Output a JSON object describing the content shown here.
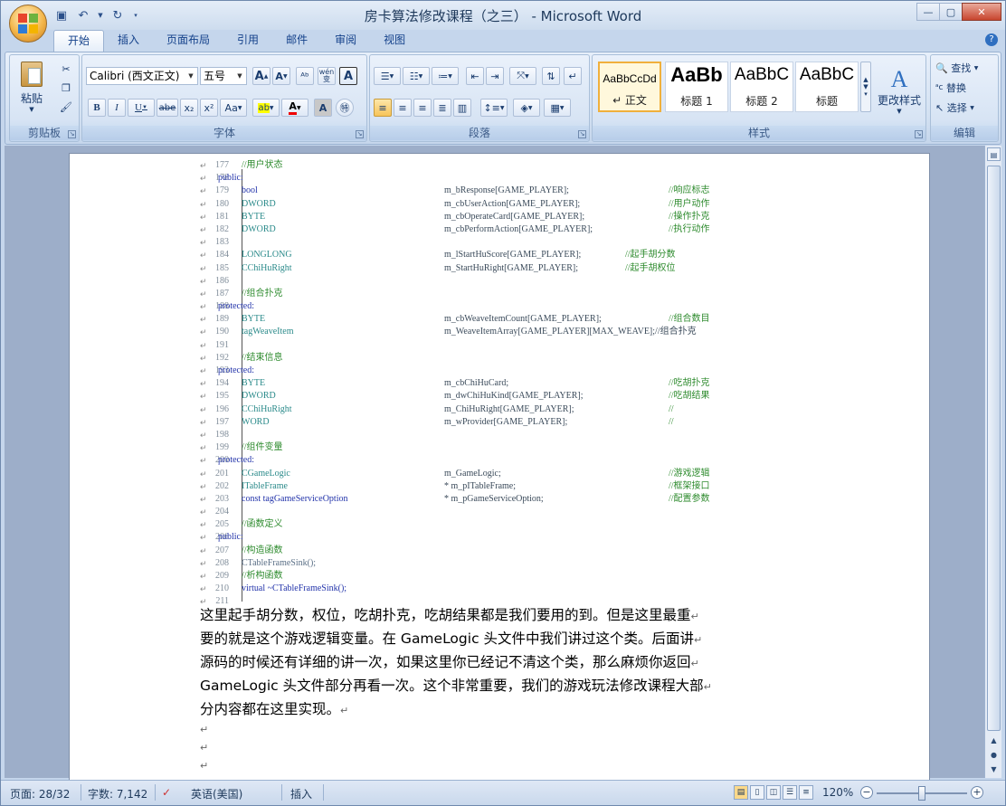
{
  "window": {
    "title": "房卡算法修改课程（之三） - Microsoft Word"
  },
  "tabs": [
    "开始",
    "插入",
    "页面布局",
    "引用",
    "邮件",
    "审阅",
    "视图"
  ],
  "clipboard": {
    "paste_label": "粘贴",
    "group_label": "剪贴板"
  },
  "font": {
    "name": "Calibri (西文正文)",
    "size": "五号",
    "group_label": "字体",
    "grow_label": "A",
    "shrink_label": "A",
    "phonetic_label": "wén",
    "bold": "B",
    "italic": "I",
    "underline": "U",
    "strike": "abe",
    "sub": "x₂",
    "sup": "x²",
    "case": "Aa",
    "highlight": "ab"
  },
  "paragraph": {
    "group_label": "段落"
  },
  "styles": {
    "group_label": "样式",
    "change_label": "更改样式",
    "items": [
      {
        "preview": "AaBbCcDd",
        "name": "↵ 正文"
      },
      {
        "preview": "AaBb",
        "name": "标题 1"
      },
      {
        "preview": "AaBbC",
        "name": "标题 2"
      },
      {
        "preview": "AaBbC",
        "name": "标题"
      }
    ]
  },
  "editing": {
    "group_label": "编辑",
    "find": "查找",
    "replace": "替换",
    "select": "选择"
  },
  "code": [
    {
      "n": "177",
      "c1": "//用户状态",
      "c2": "",
      "c3": "",
      "t": "cm"
    },
    {
      "n": "178",
      "c1": "public:",
      "c2": "",
      "c3": "",
      "t": "kw",
      "out": true
    },
    {
      "n": "179",
      "c1": "bool",
      "c2": "m_bResponse[GAME_PLAYER];",
      "c3": "//响应标志",
      "t": "kw"
    },
    {
      "n": "180",
      "c1": "DWORD",
      "c2": "m_cbUserAction[GAME_PLAYER];",
      "c3": "//用户动作",
      "t": "ty"
    },
    {
      "n": "181",
      "c1": "BYTE",
      "c2": "m_cbOperateCard[GAME_PLAYER];",
      "c3": "//操作扑克",
      "t": "ty"
    },
    {
      "n": "182",
      "c1": "DWORD",
      "c2": "m_cbPerformAction[GAME_PLAYER];",
      "c3": "//执行动作",
      "t": "ty"
    },
    {
      "n": "183",
      "c1": "",
      "c2": "",
      "c3": "",
      "t": ""
    },
    {
      "n": "184",
      "c1": "LONGLONG",
      "c2": "m_lStartHuScore[GAME_PLAYER];",
      "c3": "//起手胡分数",
      "t": "ty",
      "c3shift": true
    },
    {
      "n": "185",
      "c1": "CChiHuRight",
      "c2": "m_StartHuRight[GAME_PLAYER];",
      "c3": "//起手胡权位",
      "t": "ty",
      "c3shift": true
    },
    {
      "n": "186",
      "c1": "",
      "c2": "",
      "c3": "",
      "t": ""
    },
    {
      "n": "187",
      "c1": "//组合扑克",
      "c2": "",
      "c3": "",
      "t": "cm"
    },
    {
      "n": "188",
      "c1": "protected:",
      "c2": "",
      "c3": "",
      "t": "kw",
      "out": true
    },
    {
      "n": "189",
      "c1": "BYTE",
      "c2": "m_cbWeaveItemCount[GAME_PLAYER];",
      "c3": "//组合数目",
      "t": "ty"
    },
    {
      "n": "190",
      "c1": "tagWeaveItem",
      "c2": "m_WeaveItemArray[GAME_PLAYER][MAX_WEAVE];//组合扑克",
      "c3": "",
      "t": "ty"
    },
    {
      "n": "191",
      "c1": "",
      "c2": "",
      "c3": "",
      "t": ""
    },
    {
      "n": "192",
      "c1": "//结束信息",
      "c2": "",
      "c3": "",
      "t": "cm"
    },
    {
      "n": "193",
      "c1": "protected:",
      "c2": "",
      "c3": "",
      "t": "kw",
      "out": true
    },
    {
      "n": "194",
      "c1": "BYTE",
      "c2": "m_cbChiHuCard;",
      "c3": "//吃胡扑克",
      "t": "ty"
    },
    {
      "n": "195",
      "c1": "DWORD",
      "c2": "m_dwChiHuKind[GAME_PLAYER];",
      "c3": "//吃胡结果",
      "t": "ty"
    },
    {
      "n": "196",
      "c1": "CChiHuRight",
      "c2": "m_ChiHuRight[GAME_PLAYER];",
      "c3": "//",
      "t": "ty"
    },
    {
      "n": "197",
      "c1": "WORD",
      "c2": "m_wProvider[GAME_PLAYER];",
      "c3": "//",
      "t": "ty"
    },
    {
      "n": "198",
      "c1": "",
      "c2": "",
      "c3": "",
      "t": ""
    },
    {
      "n": "199",
      "c1": "//组件变量",
      "c2": "",
      "c3": "",
      "t": "cm"
    },
    {
      "n": "200",
      "c1": "protected:",
      "c2": "",
      "c3": "",
      "t": "kw",
      "out": true
    },
    {
      "n": "201",
      "c1": "CGameLogic",
      "c2": "m_GameLogic;",
      "c3": "//游戏逻辑",
      "t": "ty"
    },
    {
      "n": "202",
      "c1": "ITableFrame",
      "c2": "* m_pITableFrame;",
      "c3": "//框架接口",
      "t": "ty"
    },
    {
      "n": "203",
      "c1": "const tagGameServiceOption",
      "c2": "* m_pGameServiceOption;",
      "c3": "//配置参数",
      "t": "kw"
    },
    {
      "n": "204",
      "c1": "",
      "c2": "",
      "c3": "",
      "t": ""
    },
    {
      "n": "205",
      "c1": "//函数定义",
      "c2": "",
      "c3": "",
      "t": "cm"
    },
    {
      "n": "206",
      "c1": "public:",
      "c2": "",
      "c3": "",
      "t": "kw",
      "out": true
    },
    {
      "n": "207",
      "c1": "//构造函数",
      "c2": "",
      "c3": "",
      "t": "cm"
    },
    {
      "n": "208",
      "c1": "CTableFrameSink();",
      "c2": "",
      "c3": "",
      "t": ""
    },
    {
      "n": "209",
      "c1": "//析构函数",
      "c2": "",
      "c3": "",
      "t": "cm"
    },
    {
      "n": "210",
      "c1": "virtual ~CTableFrameSink();",
      "c2": "",
      "c3": "",
      "t": "kw"
    },
    {
      "n": "211",
      "c1": "",
      "c2": "",
      "c3": "",
      "t": ""
    }
  ],
  "paragraph_lines": [
    "这里起手胡分数，权位，吃胡扑克，吃胡结果都是我们要用的到。但是这里最重",
    "要的就是这个游戏逻辑变量。在 GameLogic 头文件中我们讲过这个类。后面讲",
    "源码的时候还有详细的讲一次，如果这里你已经记不清这个类，那么麻烦你返回",
    "GameLogic 头文件部分再看一次。这个非常重要，我们的游戏玩法修改课程大部",
    "分内容都在这里实现。"
  ],
  "status": {
    "page": "页面: 28/32",
    "words": "字数: 7,142",
    "language": "英语(美国)",
    "mode": "插入",
    "zoom": "120%"
  },
  "colors": {
    "ribbon": "#d3e1f2",
    "page_bg": "#ffffff",
    "doc_bg": "#9daec9"
  }
}
